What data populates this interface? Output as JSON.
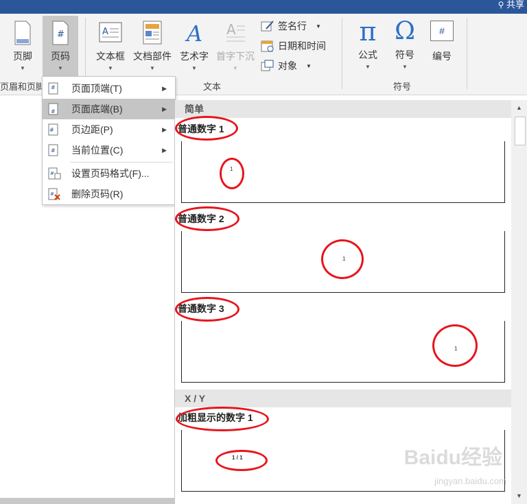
{
  "titlebar": {
    "share_label": "共享"
  },
  "ribbon": {
    "header_footer_group": {
      "buttons": [
        {
          "label": "页脚",
          "icon": "page-footer-icon"
        },
        {
          "label": "页码",
          "icon": "page-number-icon"
        }
      ],
      "label": "页眉和页脚"
    },
    "text_group": {
      "buttons": [
        {
          "label": "文本框",
          "icon": "text-box-icon"
        },
        {
          "label": "文档部件",
          "icon": "quick-parts-icon"
        },
        {
          "label": "艺术字",
          "icon": "wordart-icon"
        },
        {
          "label": "首字下沉",
          "icon": "drop-cap-icon",
          "disabled": true
        }
      ],
      "small_buttons": [
        {
          "label": "签名行",
          "icon": "signature-line-icon"
        },
        {
          "label": "日期和时间",
          "icon": "date-time-icon"
        },
        {
          "label": "对象",
          "icon": "object-icon"
        }
      ],
      "label": "文本"
    },
    "symbols_group": {
      "buttons": [
        {
          "label": "公式",
          "icon": "equation-icon",
          "glyph": "π"
        },
        {
          "label": "符号",
          "icon": "symbol-icon",
          "glyph": "Ω"
        },
        {
          "label": "编号",
          "icon": "numbering-icon",
          "glyph": "#"
        }
      ],
      "label": "符号"
    }
  },
  "page_number_menu": {
    "items": [
      {
        "label": "页面顶端(T)",
        "icon": "page-top-icon",
        "submenu": true,
        "highlighted": false
      },
      {
        "label": "页面底端(B)",
        "icon": "page-bottom-icon",
        "submenu": true,
        "highlighted": true
      },
      {
        "label": "页边距(P)",
        "icon": "page-margins-icon",
        "submenu": true,
        "highlighted": false
      },
      {
        "label": "当前位置(C)",
        "icon": "current-position-icon",
        "submenu": true,
        "highlighted": false
      },
      {
        "label": "设置页码格式(F)...",
        "icon": "format-page-numbers-icon",
        "submenu": false,
        "highlighted": false
      },
      {
        "label": "删除页码(R)",
        "icon": "remove-page-numbers-icon",
        "submenu": false,
        "highlighted": false
      }
    ]
  },
  "gallery": {
    "sections": [
      {
        "header": "简单",
        "items": [
          {
            "label": "普通数字 1",
            "sample": "1",
            "align": "left"
          },
          {
            "label": "普通数字 2",
            "sample": "1",
            "align": "center"
          },
          {
            "label": "普通数字 3",
            "sample": "1",
            "align": "right"
          }
        ]
      },
      {
        "header": "X / Y",
        "items": [
          {
            "label": "加粗显示的数字 1",
            "sample": "1 / 1",
            "align": "left"
          }
        ]
      }
    ],
    "annotation_color": "#e8141b"
  },
  "watermark": {
    "text": "Baidu经验",
    "url": "jingyan.baidu.com"
  }
}
